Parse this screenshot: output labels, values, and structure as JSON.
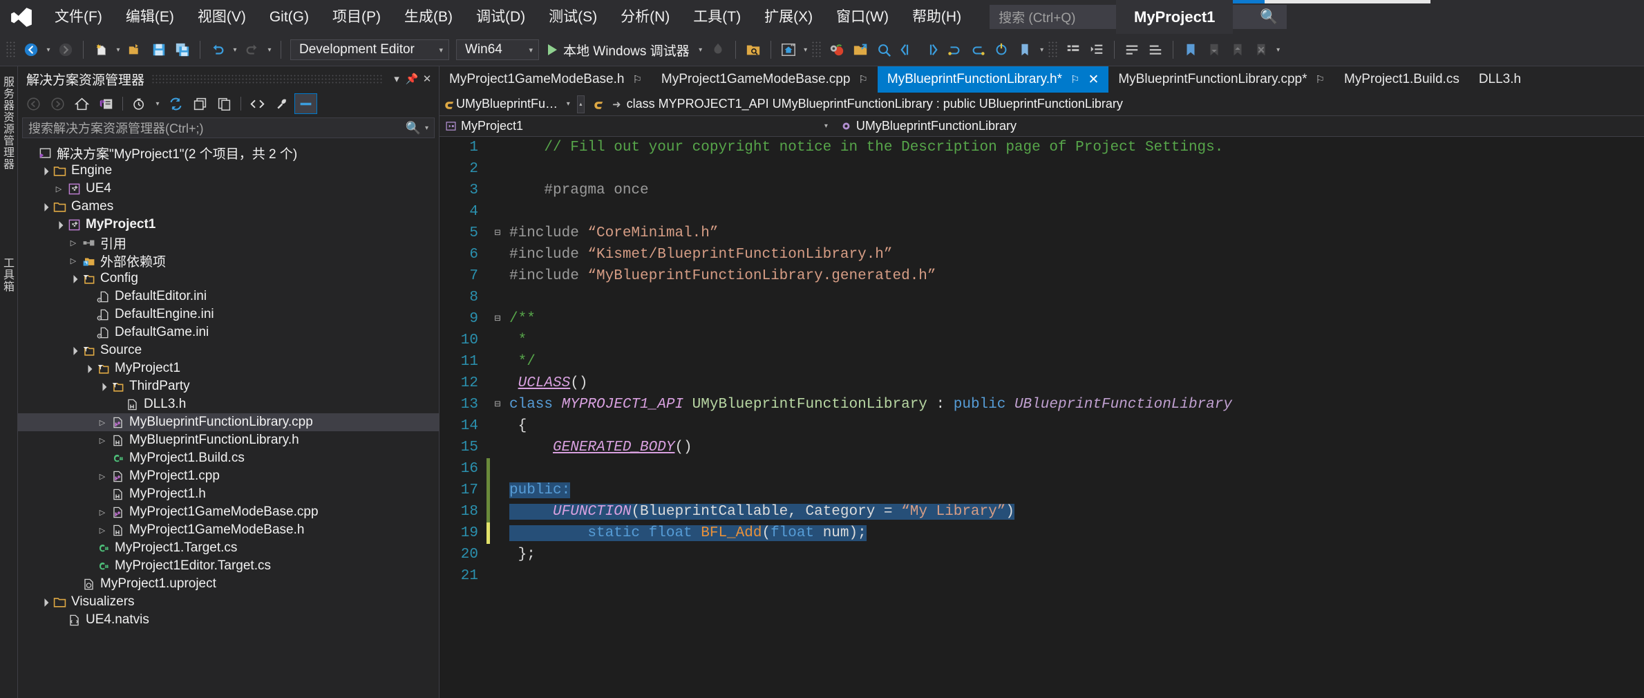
{
  "app": {
    "window_title": "MyProject1",
    "logo_icon": "visual-studio-logo"
  },
  "menubar": {
    "items": [
      {
        "label": "文件(F)"
      },
      {
        "label": "编辑(E)"
      },
      {
        "label": "视图(V)"
      },
      {
        "label": "Git(G)"
      },
      {
        "label": "项目(P)"
      },
      {
        "label": "生成(B)"
      },
      {
        "label": "调试(D)"
      },
      {
        "label": "测试(S)"
      },
      {
        "label": "分析(N)"
      },
      {
        "label": "工具(T)"
      },
      {
        "label": "扩展(X)"
      },
      {
        "label": "窗口(W)"
      },
      {
        "label": "帮助(H)"
      }
    ],
    "search": {
      "placeholder": "搜索 (Ctrl+Q)",
      "icon": "search-icon"
    }
  },
  "toolbar": {
    "nav_back": "back-arrow-icon",
    "nav_forward": "forward-arrow-icon",
    "new_item": "new-file-icon",
    "open_file": "open-folder-icon",
    "save": "save-icon",
    "save_all": "save-all-icon",
    "undo": "undo-icon",
    "redo": "redo-icon",
    "configuration": {
      "value": "Development Editor",
      "caret": "▾"
    },
    "platform": {
      "value": "Win64",
      "caret": "▾"
    },
    "run": {
      "label": "本地 Windows 调试器",
      "play_icon": "play-icon",
      "caret": "▾"
    },
    "hot_reload_icon": "hot-reload-icon",
    "icons": [
      "search-in-folder-icon",
      "home-window-icon",
      "settings-tomato-icon",
      "refactor-icon",
      "find-symbol-icon",
      "nav-back-icon",
      "nav-fwd-icon",
      "step-icon",
      "step-over-icon",
      "step-out-icon",
      "bookmark-tool-icon",
      "highlight-icon",
      "outline-icon",
      "indent-icon",
      "comment-icon",
      "uncomment-icon",
      "bookmark-icon",
      "prev-bookmark-icon",
      "next-bookmark-icon",
      "clear-bookmark-icon"
    ]
  },
  "left_strips": [
    {
      "label": "服务器资源管理器"
    },
    {
      "label": "工具箱"
    }
  ],
  "solution_explorer": {
    "title": "解决方案资源管理器",
    "header_buttons": [
      {
        "icon": "chevron-down-icon"
      },
      {
        "icon": "pin-icon"
      },
      {
        "icon": "close-icon"
      }
    ],
    "toolbar_icons": [
      {
        "icon": "back-arrow-icon",
        "enabled": false
      },
      {
        "icon": "forward-arrow-icon",
        "enabled": false
      },
      {
        "icon": "home-icon",
        "enabled": true
      },
      {
        "icon": "solution-view-icon",
        "enabled": true
      },
      {
        "icon": "pending-changes-icon",
        "enabled": true
      },
      {
        "icon": "refresh-icon",
        "enabled": true
      },
      {
        "icon": "collapse-all-icon",
        "enabled": true
      },
      {
        "icon": "show-all-files-icon",
        "enabled": true
      },
      {
        "icon": "view-code-icon",
        "enabled": true
      },
      {
        "icon": "properties-wrench-icon",
        "enabled": true
      },
      {
        "icon": "preview-selected-icon",
        "enabled": true
      }
    ],
    "search": {
      "placeholder": "搜索解决方案资源管理器(Ctrl+;)",
      "icon": "search-icon",
      "caret": "▾"
    },
    "tree": [
      {
        "depth": 0,
        "expander": "none",
        "icon": "solution-icon",
        "label": "解决方案\"MyProject1\"(2 个项目，共 2 个)",
        "bold": false,
        "selected": false
      },
      {
        "depth": 1,
        "expander": "open",
        "icon": "folder-icon",
        "label": "Engine",
        "bold": false,
        "selected": false
      },
      {
        "depth": 2,
        "expander": "closed",
        "icon": "cpp-project-icon",
        "label": "UE4",
        "bold": false,
        "selected": false
      },
      {
        "depth": 1,
        "expander": "open",
        "icon": "folder-icon",
        "label": "Games",
        "bold": false,
        "selected": false
      },
      {
        "depth": 2,
        "expander": "open",
        "icon": "cpp-project-icon",
        "label": "MyProject1",
        "bold": true,
        "selected": false
      },
      {
        "depth": 3,
        "expander": "closed",
        "icon": "references-icon",
        "label": "引用",
        "bold": false,
        "selected": false
      },
      {
        "depth": 3,
        "expander": "closed",
        "icon": "ext-deps-icon",
        "label": "外部依赖项",
        "bold": false,
        "selected": false
      },
      {
        "depth": 3,
        "expander": "open",
        "icon": "filter-folder-icon",
        "label": "Config",
        "bold": false,
        "selected": false
      },
      {
        "depth": 4,
        "expander": "none",
        "icon": "ini-file-icon",
        "label": "DefaultEditor.ini",
        "bold": false,
        "selected": false
      },
      {
        "depth": 4,
        "expander": "none",
        "icon": "ini-file-icon",
        "label": "DefaultEngine.ini",
        "bold": false,
        "selected": false
      },
      {
        "depth": 4,
        "expander": "none",
        "icon": "ini-file-icon",
        "label": "DefaultGame.ini",
        "bold": false,
        "selected": false
      },
      {
        "depth": 3,
        "expander": "open",
        "icon": "filter-folder-icon",
        "label": "Source",
        "bold": false,
        "selected": false
      },
      {
        "depth": 4,
        "expander": "open",
        "icon": "filter-folder-icon",
        "label": "MyProject1",
        "bold": false,
        "selected": false
      },
      {
        "depth": 5,
        "expander": "open",
        "icon": "filter-folder-icon",
        "label": "ThirdParty",
        "bold": false,
        "selected": false
      },
      {
        "depth": 6,
        "expander": "none",
        "icon": "h-file-icon",
        "label": "DLL3.h",
        "bold": false,
        "selected": false
      },
      {
        "depth": 5,
        "expander": "closed",
        "icon": "cpp-file-icon",
        "label": "MyBlueprintFunctionLibrary.cpp",
        "bold": false,
        "selected": true
      },
      {
        "depth": 5,
        "expander": "closed",
        "icon": "h-file-icon",
        "label": "MyBlueprintFunctionLibrary.h",
        "bold": false,
        "selected": false
      },
      {
        "depth": 5,
        "expander": "none",
        "icon": "cs-file-icon",
        "label": "MyProject1.Build.cs",
        "bold": false,
        "selected": false
      },
      {
        "depth": 5,
        "expander": "closed",
        "icon": "cpp-file-icon",
        "label": "MyProject1.cpp",
        "bold": false,
        "selected": false
      },
      {
        "depth": 5,
        "expander": "none",
        "icon": "h-file-icon",
        "label": "MyProject1.h",
        "bold": false,
        "selected": false
      },
      {
        "depth": 5,
        "expander": "closed",
        "icon": "cpp-file-icon",
        "label": "MyProject1GameModeBase.cpp",
        "bold": false,
        "selected": false
      },
      {
        "depth": 5,
        "expander": "closed",
        "icon": "h-file-icon",
        "label": "MyProject1GameModeBase.h",
        "bold": false,
        "selected": false
      },
      {
        "depth": 4,
        "expander": "none",
        "icon": "cs-file-icon",
        "label": "MyProject1.Target.cs",
        "bold": false,
        "selected": false
      },
      {
        "depth": 4,
        "expander": "none",
        "icon": "cs-file-icon",
        "label": "MyProject1Editor.Target.cs",
        "bold": false,
        "selected": false
      },
      {
        "depth": 3,
        "expander": "none",
        "icon": "uproject-icon",
        "label": "MyProject1.uproject",
        "bold": false,
        "selected": false
      },
      {
        "depth": 1,
        "expander": "open",
        "icon": "folder-icon",
        "label": "Visualizers",
        "bold": false,
        "selected": false
      },
      {
        "depth": 2,
        "expander": "none",
        "icon": "natvis-file-icon",
        "label": "UE4.natvis",
        "bold": false,
        "selected": false
      }
    ]
  },
  "editor": {
    "tabs": [
      {
        "label": "MyProject1GameModeBase.h",
        "active": false,
        "pinned": true,
        "closable": false
      },
      {
        "label": "MyProject1GameModeBase.cpp",
        "active": false,
        "pinned": true,
        "closable": false
      },
      {
        "label": "MyBlueprintFunctionLibrary.h*",
        "active": true,
        "pinned": true,
        "closable": true
      },
      {
        "label": "MyBlueprintFunctionLibrary.cpp*",
        "active": false,
        "pinned": true,
        "closable": false
      },
      {
        "label": "MyProject1.Build.cs",
        "active": false,
        "pinned": false,
        "closable": false
      },
      {
        "label": "DLL3.h",
        "active": false,
        "pinned": false,
        "closable": false
      }
    ],
    "navbar": {
      "project_scope": "UMyBlueprintFunctionLib",
      "member_scope": "class MYPROJECT1_API UMyBlueprintFunctionLibrary : public UBlueprintFunctionLibrary",
      "left_icon": "cpp-class-icon",
      "right_icon": "cpp-class-icon",
      "caret": "▾",
      "arrow": "➜"
    },
    "breadcrumb": {
      "project": "MyProject1",
      "project_icon": "project-icon",
      "symbol": "UMyBlueprintFunctionLibrary",
      "symbol_icon": "class-icon",
      "caret": "▾"
    }
  },
  "code": {
    "lines": [
      {
        "n": "1",
        "change": "none",
        "fold": "",
        "tokens": [
          {
            "t": "    // Fill out your copyright notice in the Description page of Project Settings.",
            "c": "c-com"
          }
        ]
      },
      {
        "n": "2",
        "change": "none",
        "fold": "",
        "tokens": []
      },
      {
        "n": "3",
        "change": "none",
        "fold": "",
        "tokens": [
          {
            "t": "    #pragma once",
            "c": "c-pp"
          }
        ]
      },
      {
        "n": "4",
        "change": "none",
        "fold": "",
        "tokens": []
      },
      {
        "n": "5",
        "change": "none",
        "fold": "⊟",
        "tokens": [
          {
            "t": "#include ",
            "c": "c-pp"
          },
          {
            "t": "“CoreMinimal.h”",
            "c": "c-str"
          }
        ]
      },
      {
        "n": "6",
        "change": "none",
        "fold": "",
        "tokens": [
          {
            "t": "#include ",
            "c": "c-pp"
          },
          {
            "t": "“Kismet/BlueprintFunctionLibrary.h”",
            "c": "c-str"
          }
        ]
      },
      {
        "n": "7",
        "change": "none",
        "fold": "",
        "tokens": [
          {
            "t": "#include ",
            "c": "c-pp"
          },
          {
            "t": "“MyBlueprintFunctionLibrary.generated.h”",
            "c": "c-str"
          }
        ]
      },
      {
        "n": "8",
        "change": "none",
        "fold": "",
        "tokens": []
      },
      {
        "n": "9",
        "change": "none",
        "fold": "⊟",
        "tokens": [
          {
            "t": "/**",
            "c": "c-com"
          }
        ]
      },
      {
        "n": "10",
        "change": "none",
        "fold": "",
        "tokens": [
          {
            "t": " *",
            "c": "c-com"
          }
        ]
      },
      {
        "n": "11",
        "change": "none",
        "fold": "",
        "tokens": [
          {
            "t": " */",
            "c": "c-com"
          }
        ]
      },
      {
        "n": "12",
        "change": "none",
        "fold": "",
        "tokens": [
          {
            "t": " ",
            "c": "c-plain"
          },
          {
            "t": "UCLASS",
            "c": "c-ital"
          },
          {
            "t": "()",
            "c": "c-plain"
          }
        ]
      },
      {
        "n": "13",
        "change": "none",
        "fold": "⊟",
        "tokens": [
          {
            "t": "class ",
            "c": "c-kw"
          },
          {
            "t": "MYPROJECT1_API ",
            "c": "c-mac2"
          },
          {
            "t": "UMyBlueprintFunctionLibrary ",
            "c": "c-cls"
          },
          {
            "t": ": ",
            "c": "c-plain"
          },
          {
            "t": "public ",
            "c": "c-kw"
          },
          {
            "t": "UBlueprintFunctionLibrary",
            "c": "c-itblue"
          }
        ]
      },
      {
        "n": "14",
        "change": "none",
        "fold": "",
        "tokens": [
          {
            "t": " {",
            "c": "c-plain"
          }
        ]
      },
      {
        "n": "15",
        "change": "none",
        "fold": "",
        "tokens": [
          {
            "t": "     ",
            "c": "c-plain"
          },
          {
            "t": "GENERATED_BODY",
            "c": "c-ital"
          },
          {
            "t": "()",
            "c": "c-plain"
          }
        ]
      },
      {
        "n": "16",
        "change": "green",
        "fold": "",
        "tokens": []
      },
      {
        "n": "17",
        "change": "green",
        "fold": "",
        "sel": true,
        "tokens": [
          {
            "t": "public:",
            "c": "c-kw"
          }
        ]
      },
      {
        "n": "18",
        "change": "green",
        "fold": "",
        "sel": true,
        "tokens": [
          {
            "t": "     ",
            "c": "c-plain"
          },
          {
            "t": "UFUNCTION",
            "c": "c-mac2"
          },
          {
            "t": "(",
            "c": "c-plain"
          },
          {
            "t": "BlueprintCallable, Category = ",
            "c": "c-plain"
          },
          {
            "t": "“My Library”",
            "c": "c-str"
          },
          {
            "t": ")",
            "c": "c-plain"
          }
        ]
      },
      {
        "n": "19",
        "change": "yellow",
        "fold": "",
        "sel": true,
        "tokens": [
          {
            "t": "         ",
            "c": "c-plain"
          },
          {
            "t": "static float ",
            "c": "c-kw"
          },
          {
            "t": "BFL_Add",
            "c": "c-fn"
          },
          {
            "t": "(",
            "c": "c-plain"
          },
          {
            "t": "float ",
            "c": "c-kw"
          },
          {
            "t": "num",
            "c": "c-plain"
          },
          {
            "t": ");",
            "c": "c-plain"
          }
        ]
      },
      {
        "n": "20",
        "change": "none",
        "fold": "",
        "tokens": [
          {
            "t": " };",
            "c": "c-plain"
          }
        ]
      },
      {
        "n": "21",
        "change": "none",
        "fold": "",
        "tokens": []
      }
    ]
  },
  "colors": {
    "accent": "#007acc",
    "chrome": "#2d2d30",
    "panel": "#252526",
    "editor_bg": "#1e1e1e",
    "selection": "#264f78",
    "comment_green": "#57a64a",
    "string_orange": "#d69d85",
    "keyword_blue": "#569cd6",
    "linenum_teal": "#2b91af"
  }
}
